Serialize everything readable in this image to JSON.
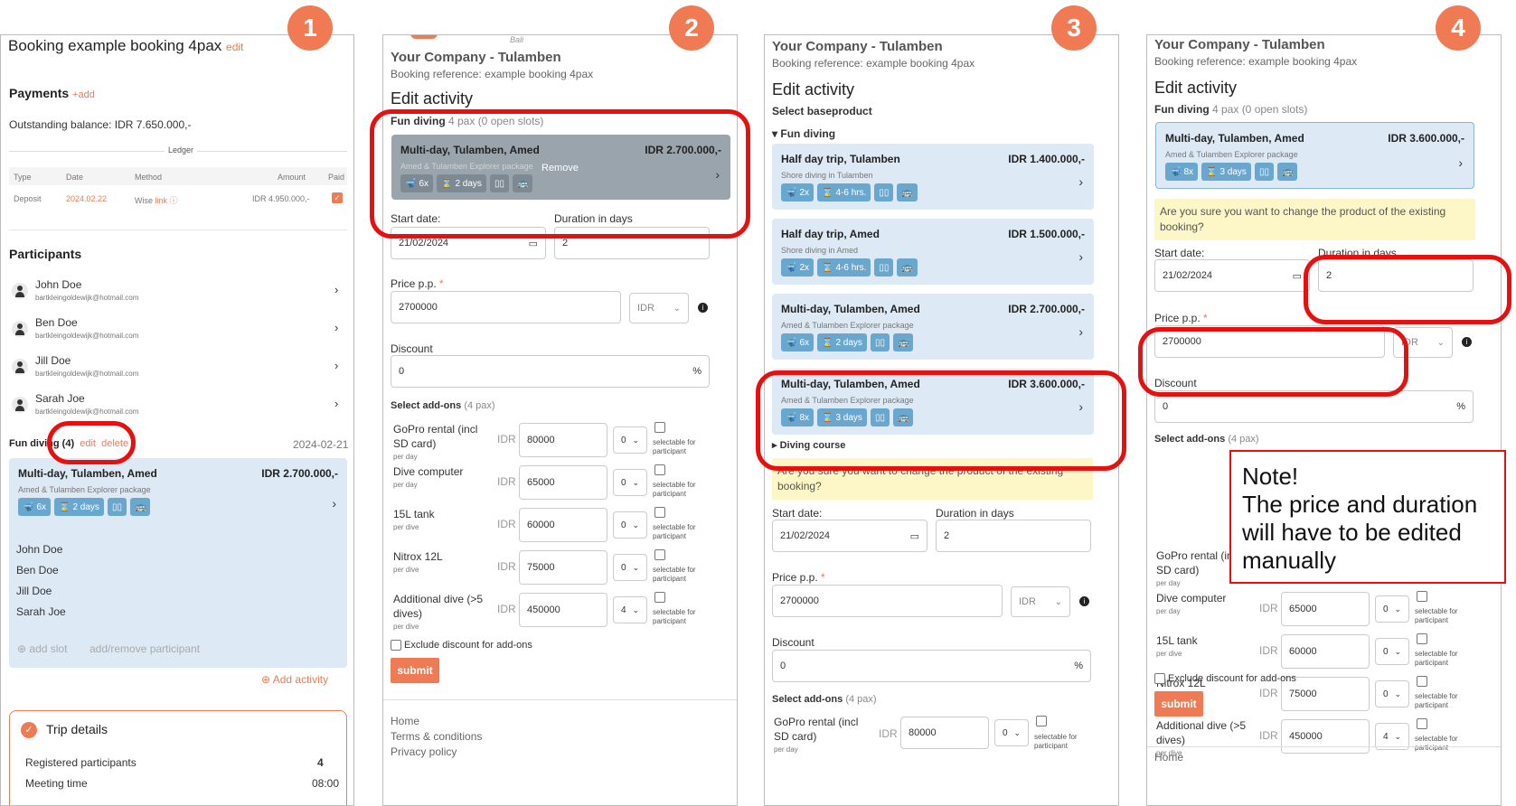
{
  "badges": [
    "1",
    "2",
    "3",
    "4"
  ],
  "p1": {
    "title": "Booking example booking 4pax",
    "title_edit": "edit",
    "payments_heading": "Payments",
    "payments_add": "+add",
    "outstanding": "Outstanding balance: IDR 7.650.000,-",
    "ledger": "Ledger",
    "ledger_cols": [
      "Type",
      "Date",
      "Method",
      "Amount",
      "Paid"
    ],
    "ledger_row": {
      "type": "Deposit",
      "date": "2024.02.22",
      "method": "Wise",
      "link": "link",
      "amount": "IDR 4.950.000,-"
    },
    "participants_heading": "Participants",
    "participants": [
      {
        "name": "John Doe",
        "email": "bartkleingoldewijk@hotmail.com"
      },
      {
        "name": "Ben Doe",
        "email": "bartkleingoldewijk@hotmail.com"
      },
      {
        "name": "Jill Doe",
        "email": "bartkleingoldewijk@hotmail.com"
      },
      {
        "name": "Sarah Joe",
        "email": "bartkleingoldewijk@hotmail.com"
      }
    ],
    "activity_title": "Fun diving (4)",
    "activity_edit": "edit",
    "activity_delete": "delete",
    "activity_date": "2024-02-21",
    "card": {
      "title": "Multi-day, Tulamben, Amed",
      "price": "IDR 2.700.000,-",
      "sub": "Amed & Tulamben Explorer package",
      "dives": "6x",
      "days": "2 days"
    },
    "slot_names": [
      "John Doe",
      "Ben Doe",
      "Jill Doe",
      "Sarah Joe"
    ],
    "add_slot": "add slot",
    "add_remove": "add/remove participant",
    "add_activity": "Add activity",
    "trip_details": "Trip details",
    "registered_label": "Registered participants",
    "registered_value": "4",
    "meeting_label": "Meeting time",
    "meeting_value": "08:00"
  },
  "shared": {
    "company": "Your Company - Tulamben",
    "booking_ref": "Booking reference: example booking 4pax",
    "edit_activity": "Edit activity",
    "fun_diving": "Fun diving",
    "pax": "4 pax (0 open slots)",
    "start_date": "Start date:",
    "date_value": "21/02/2024",
    "duration_label": "Duration in days",
    "duration_value": "2",
    "price_label": "Price p.p.",
    "required": "*",
    "price_value": "2700000",
    "currency": "IDR",
    "discount_label": "Discount",
    "discount_value": "0",
    "percent": "%",
    "addons_label": "Select add-ons",
    "addons_pax": "(4 pax)",
    "exclude": "Exclude discount for add-ons",
    "submit": "submit",
    "selectable": "selectable for participant",
    "warning": "Are you sure you want to change the product of the existing booking?",
    "addons": [
      {
        "name": "GoPro rental (incl SD card)",
        "unit": "per day",
        "price": "80000",
        "qty": "0"
      },
      {
        "name": "Dive computer",
        "unit": "per day",
        "price": "65000",
        "qty": "0"
      },
      {
        "name": "15L tank",
        "unit": "per dive",
        "price": "60000",
        "qty": "0"
      },
      {
        "name": "Nitrox 12L",
        "unit": "per dive",
        "price": "75000",
        "qty": "0"
      },
      {
        "name": "Additional dive (>5 dives)",
        "unit": "per dive",
        "price": "450000",
        "qty": "4"
      }
    ]
  },
  "p2": {
    "logo": "Bali",
    "remove": "Remove",
    "card": {
      "title": "Multi-day, Tulamben, Amed",
      "price": "IDR 2.700.000,-",
      "sub": "Amed & Tulamben Explorer package",
      "dives": "6x",
      "days": "2 days"
    },
    "footer": [
      "Home",
      "Terms & conditions",
      "Privacy policy"
    ]
  },
  "p3": {
    "select_base": "Select baseproduct",
    "group_fun": "Fun diving",
    "group_course": "Diving course",
    "products": [
      {
        "title": "Half day trip, Tulamben",
        "price": "IDR 1.400.000,-",
        "sub": "Shore diving in Tulamben",
        "dives": "2x",
        "days": "4-6 hrs."
      },
      {
        "title": "Half day trip, Amed",
        "price": "IDR 1.500.000,-",
        "sub": "Shore diving in Amed",
        "dives": "2x",
        "days": "4-6 hrs."
      },
      {
        "title": "Multi-day, Tulamben, Amed",
        "price": "IDR 2.700.000,-",
        "sub": "Amed & Tulamben Explorer package",
        "dives": "6x",
        "days": "2 days"
      },
      {
        "title": "Multi-day, Tulamben, Amed",
        "price": "IDR 3.600.000,-",
        "sub": "Amed & Tulamben Explorer package",
        "dives": "8x",
        "days": "3 days"
      }
    ]
  },
  "p4": {
    "card": {
      "title": "Multi-day, Tulamben, Amed",
      "price": "IDR 3.600.000,-",
      "sub": "Amed & Tulamben Explorer package",
      "dives": "8x",
      "days": "3 days"
    },
    "footer": "Home"
  },
  "note": {
    "line1": "Note!",
    "line2": "The price and duration will have to be edited manually"
  },
  "colors": {
    "accent": "#f07a54",
    "highlight": "#e8100f",
    "card": "#dde9f4",
    "chip": "#6aa7cf",
    "warning": "#fdf7c8"
  }
}
